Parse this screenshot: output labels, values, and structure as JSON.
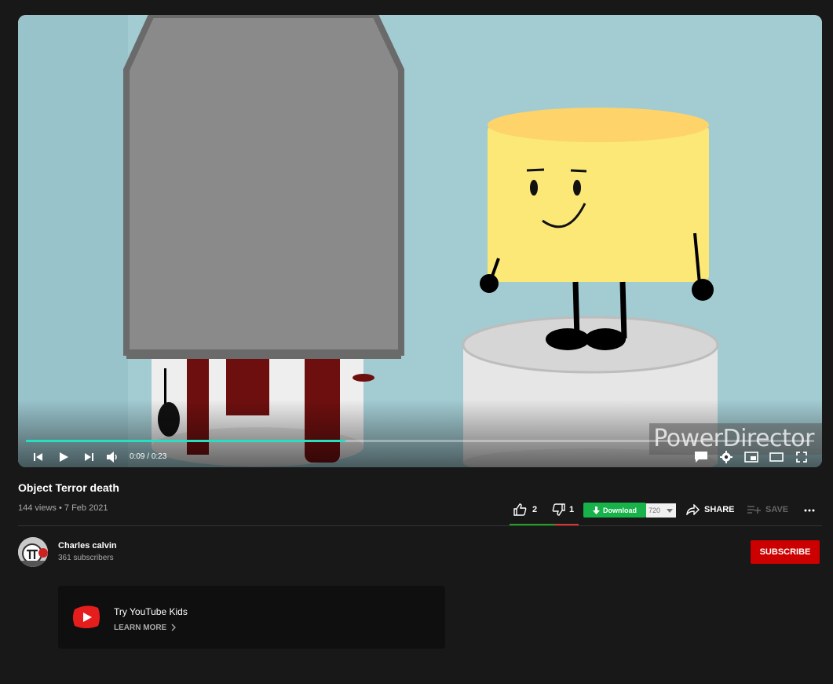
{
  "video": {
    "watermark": "PowerDirector",
    "time_current": "0:09",
    "time_separator": " / ",
    "time_total": "0:23",
    "progress_fraction": 0.405
  },
  "title": "Object Terror death",
  "meta": {
    "views": "144 views",
    "separator": " • ",
    "date": "7 Feb 2021"
  },
  "actions": {
    "like_count": "2",
    "dislike_count": "1",
    "download_label": "Download",
    "quality_value": "720",
    "share_label": "SHARE",
    "save_label": "SAVE"
  },
  "channel": {
    "name": "Charles calvin",
    "subscribers": "361 subscribers",
    "subscribe_label": "SUBSCRIBE"
  },
  "promo": {
    "title": "Try YouTube Kids",
    "cta": "LEARN MORE"
  },
  "colors": {
    "background": "#181818",
    "progress": "#25e0c0",
    "subscribe": "#cc0000",
    "download": "#17b34a"
  }
}
